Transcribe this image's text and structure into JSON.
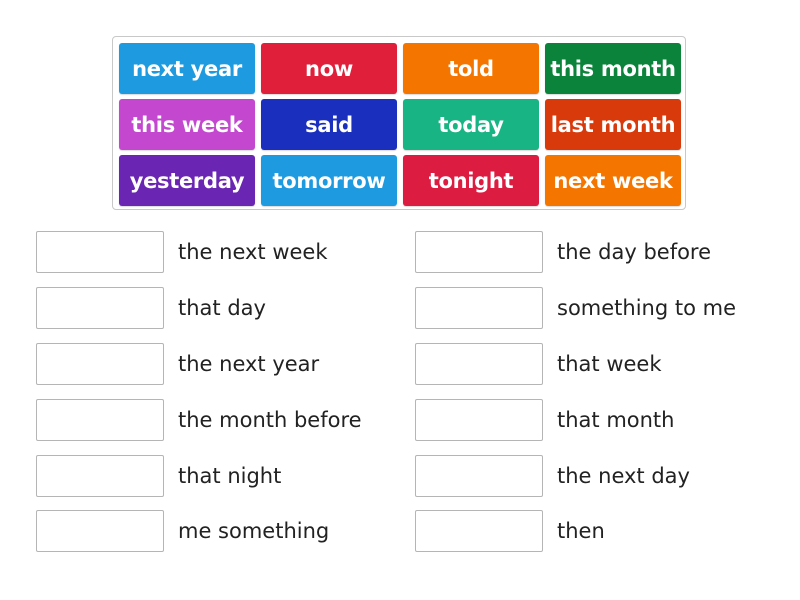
{
  "word_bank": [
    {
      "text": "next year",
      "color": "#1e9be0"
    },
    {
      "text": "now",
      "color": "#e0203a"
    },
    {
      "text": "told",
      "color": "#f47500"
    },
    {
      "text": "this month",
      "color": "#0b833a"
    },
    {
      "text": "this week",
      "color": "#c348cf"
    },
    {
      "text": "said",
      "color": "#1b2fbf"
    },
    {
      "text": "today",
      "color": "#19b483"
    },
    {
      "text": "last month",
      "color": "#d93a0b"
    },
    {
      "text": "yesterday",
      "color": "#6a25b2"
    },
    {
      "text": "tomorrow",
      "color": "#1e9be0"
    },
    {
      "text": "tonight",
      "color": "#dc1c40"
    },
    {
      "text": "next week",
      "color": "#f47500"
    }
  ],
  "left_column": [
    {
      "label": "the next week"
    },
    {
      "label": "that day"
    },
    {
      "label": "the next year"
    },
    {
      "label": "the month before"
    },
    {
      "label": "that night"
    },
    {
      "label": "me something"
    }
  ],
  "right_column": [
    {
      "label": "the day before"
    },
    {
      "label": "something to me"
    },
    {
      "label": "that week"
    },
    {
      "label": "that month"
    },
    {
      "label": "the next day"
    },
    {
      "label": "then"
    }
  ]
}
